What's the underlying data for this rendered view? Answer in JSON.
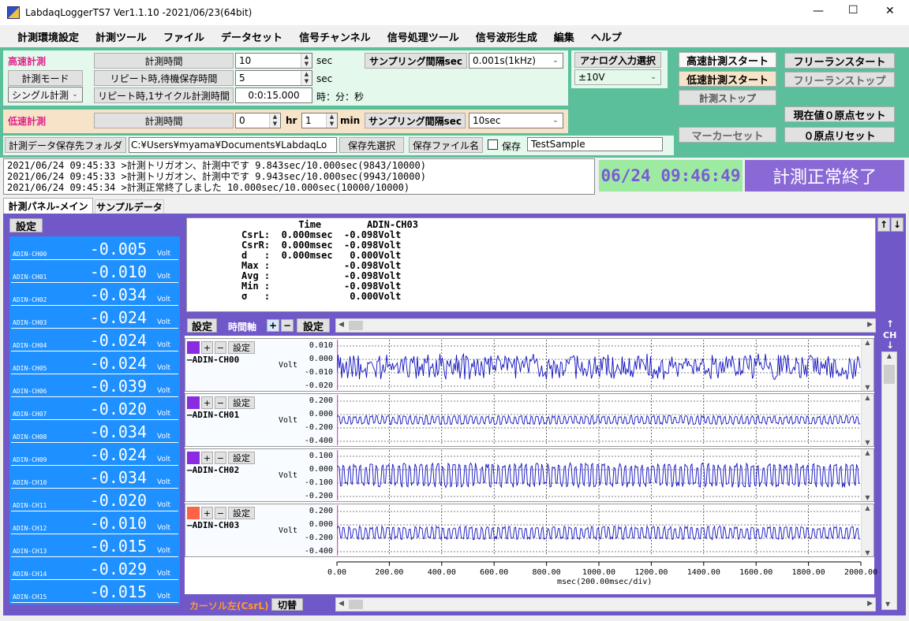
{
  "window": {
    "title": "LabdaqLoggerTS7 Ver1.1.10 -2021/06/23(64bit)",
    "min": "—",
    "max": "☐",
    "close": "✕"
  },
  "menu": [
    "計測環境設定",
    "計測ツール",
    "ファイル",
    "データセット",
    "信号チャンネル",
    "信号処理ツール",
    "信号波形生成",
    "編集",
    "ヘルプ"
  ],
  "fast": {
    "label": "高速計測",
    "mode_btn": "計測モード",
    "mode_value": "シングル計測",
    "time_btn": "計測時間",
    "time_value": "10",
    "time_unit": "sec",
    "wait_btn": "リピート時,待機保存時間",
    "wait_value": "5",
    "wait_unit": "sec",
    "cycle_btn": "リピート時,1サイクル計測時間",
    "cycle_value": "0:0:15.000",
    "cycle_unit": "時：分：秒",
    "sampling_btn": "サンプリング間隔sec",
    "sampling_value": "0.001s(1kHz)"
  },
  "analog": {
    "btn": "アナログ入力選択",
    "value": "±10V"
  },
  "slow": {
    "label": "低速計測",
    "time_btn": "計測時間",
    "hr_value": "0",
    "hr_unit": "hr",
    "min_value": "1",
    "min_unit": "min",
    "sampling_btn": "サンプリング間隔sec",
    "sampling_value": "10sec"
  },
  "folder": {
    "btn": "計測データ保存先フォルダ",
    "path": "C:¥Users¥myama¥Documents¥LabdaqLo",
    "select_btn": "保存先選択",
    "name_btn": "保存ファイル名",
    "save_label": "保存",
    "filename": "TestSample"
  },
  "controls": {
    "fast_start": "高速計測スタート",
    "slow_start": "低速計測スタート",
    "stop": "計測ストップ",
    "free_start": "フリーランスタート",
    "free_stop": "フリーランストップ",
    "zero_set": "現在値０原点セット",
    "marker": "マーカーセット",
    "zero_reset": "０原点リセット"
  },
  "log": [
    "2021/06/24 09:45:33 >計測トリガオン、計測中です 9.843sec/10.000sec(9843/10000)",
    "2021/06/24 09:45:33 >計測トリガオン、計測中です 9.943sec/10.000sec(9943/10000)",
    "2021/06/24 09:45:34 >計測正常終了しました 10.000sec/10.000sec(10000/10000)"
  ],
  "clock": "06/24 09:46:49",
  "status": "計測正常終了",
  "colors": {
    "accent": "#7b5ad6",
    "green": "#5abf9a",
    "fast_bg": "#e4f8ec",
    "slow_bg": "#f7e3c7",
    "clock_bg": "#9ceba0",
    "status_bg": "#8a69d6",
    "panel_blue": "#1e90ff"
  },
  "tabs": [
    "計測パネル-メイン",
    "サンプルデータ"
  ],
  "channels_panel": {
    "settings": "設定",
    "unit": "Volt",
    "items": [
      {
        "name": "ADIN-CH00",
        "value": "-0.005"
      },
      {
        "name": "ADIN-CH01",
        "value": "-0.010"
      },
      {
        "name": "ADIN-CH02",
        "value": "-0.034"
      },
      {
        "name": "ADIN-CH03",
        "value": "-0.024"
      },
      {
        "name": "ADIN-CH04",
        "value": "-0.024"
      },
      {
        "name": "ADIN-CH05",
        "value": "-0.024"
      },
      {
        "name": "ADIN-CH06",
        "value": "-0.039"
      },
      {
        "name": "ADIN-CH07",
        "value": "-0.020"
      },
      {
        "name": "ADIN-CH08",
        "value": "-0.034"
      },
      {
        "name": "ADIN-CH09",
        "value": "-0.024"
      },
      {
        "name": "ADIN-CH10",
        "value": "-0.034"
      },
      {
        "name": "ADIN-CH11",
        "value": "-0.020"
      },
      {
        "name": "ADIN-CH12",
        "value": "-0.010"
      },
      {
        "name": "ADIN-CH13",
        "value": "-0.015"
      },
      {
        "name": "ADIN-CH14",
        "value": "-0.029"
      },
      {
        "name": "ADIN-CH15",
        "value": "-0.015"
      }
    ]
  },
  "cursor_info": [
    "          Time        ADIN-CH03",
    "CsrL:  0.000msec  -0.098Volt",
    "CsrR:  0.000msec  -0.098Volt",
    "d   :  0.000msec   0.000Volt",
    "Max :             -0.098Volt",
    "Avg :             -0.098Volt",
    "Min :             -0.098Volt",
    "σ   :              0.000Volt"
  ],
  "plot_toolbar": {
    "settings": "設定",
    "time_axis": "時間軸",
    "plus": "+",
    "minus": "−",
    "settings2": "設定"
  },
  "plots": [
    {
      "name": "—ADIN-CH00",
      "color": "#8a2be2",
      "unit": "Volt",
      "ticks": [
        "0.010",
        "0.000",
        "-0.010",
        "-0.020"
      ]
    },
    {
      "name": "—ADIN-CH01",
      "color": "#8a2be2",
      "unit": "Volt",
      "ticks": [
        "0.200",
        "0.000",
        "-0.200",
        "-0.400"
      ]
    },
    {
      "name": "—ADIN-CH02",
      "color": "#8a2be2",
      "unit": "Volt",
      "ticks": [
        "0.100",
        "0.000",
        "-0.100",
        "-0.200"
      ]
    },
    {
      "name": "—ADIN-CH03",
      "color": "#ff6347",
      "unit": "Volt",
      "ticks": [
        "0.200",
        "0.000",
        "-0.200",
        "-0.400"
      ]
    }
  ],
  "plot_ctrl": {
    "plus": "+",
    "minus": "−",
    "settings": "設定"
  },
  "x_axis": {
    "ticks": [
      "0.00",
      "200.00",
      "400.00",
      "600.00",
      "800.00",
      "1000.00",
      "1200.00",
      "1400.00",
      "1600.00",
      "1800.00",
      "2000.00"
    ],
    "label": "msec(200.00msec/div)"
  },
  "cursor_label": "カーソル左(CsrL)",
  "switch_btn": "切替",
  "ch_label": "CH",
  "arrows": {
    "up": "↑",
    "down": "↓"
  }
}
